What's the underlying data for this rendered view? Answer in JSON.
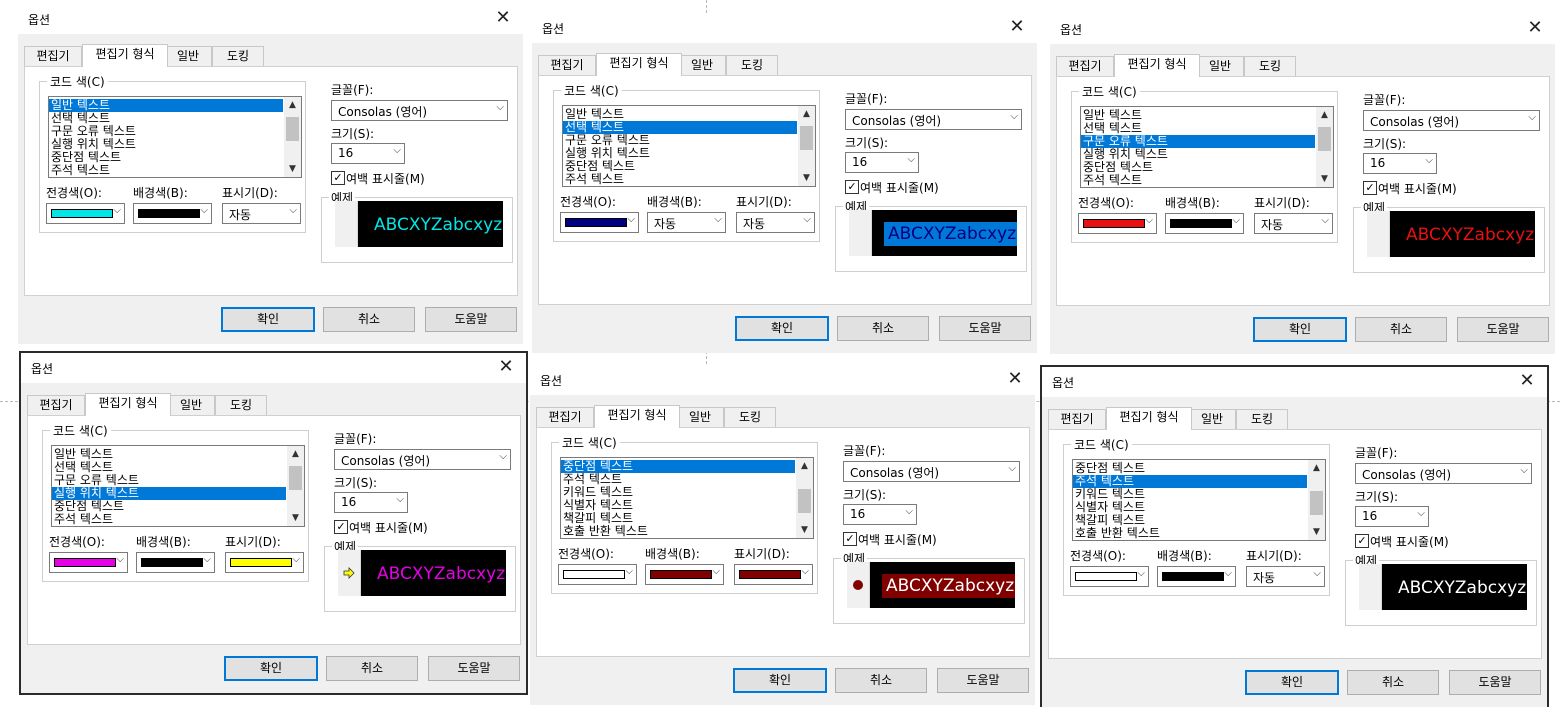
{
  "dialog": {
    "title": "옵션",
    "close_symbol": "✕",
    "tabs": [
      "편집기",
      "편집기 형식",
      "일반",
      "도킹"
    ],
    "group_label": "코드 색(C)",
    "fg_label": "전경색(O):",
    "bg_label": "배경색(B):",
    "indicator_label": "표시기(D):",
    "font_label": "글꼴(F):",
    "font_value": "Consolas (영어)",
    "size_label": "크기(S):",
    "size_value": "16",
    "margin_label": "여백 표시줄(M)",
    "margin_checked": true,
    "sample_label": "예제",
    "sample_text": "ABCXYZabcxyz",
    "buttons": [
      "확인",
      "취소",
      "도움말"
    ]
  },
  "panels": [
    {
      "items": [
        "일반 텍스트",
        "선택 텍스트",
        "구문 오류 텍스트",
        "실행 위치 텍스트",
        "중단점 텍스트",
        "주석 텍스트"
      ],
      "selected": 0,
      "thumb": 0.15,
      "fg": {
        "swatch": "#00e5e5"
      },
      "bg": {
        "swatch": "#000000"
      },
      "ind": {
        "text": "자동"
      },
      "preview": {
        "fg": "#00e5e5",
        "bg": "#000000"
      },
      "marker": "none"
    },
    {
      "items": [
        "일반 텍스트",
        "선택 텍스트",
        "구문 오류 텍스트",
        "실행 위치 텍스트",
        "중단점 텍스트",
        "주석 텍스트"
      ],
      "selected": 1,
      "thumb": 0.15,
      "fg": {
        "swatch": "#000080"
      },
      "bg": {
        "text": "자동"
      },
      "ind": {
        "text": "자동"
      },
      "preview": {
        "fg": "#000080",
        "bg": "#0078d7"
      },
      "marker": "none"
    },
    {
      "items": [
        "일반 텍스트",
        "선택 텍스트",
        "구문 오류 텍스트",
        "실행 위치 텍스트",
        "중단점 텍스트",
        "주석 텍스트"
      ],
      "selected": 2,
      "thumb": 0.15,
      "fg": {
        "swatch": "#e81010"
      },
      "bg": {
        "swatch": "#000000"
      },
      "ind": {
        "text": "자동"
      },
      "preview": {
        "fg": "#e81010",
        "bg": "#000000"
      },
      "marker": "none"
    },
    {
      "items": [
        "일반 텍스트",
        "선택 텍스트",
        "구문 오류 텍스트",
        "실행 위치 텍스트",
        "중단점 텍스트",
        "주석 텍스트"
      ],
      "selected": 3,
      "thumb": 0.15,
      "fg": {
        "swatch": "#e600e6"
      },
      "bg": {
        "swatch": "#000000"
      },
      "ind": {
        "swatch": "#ffff00"
      },
      "preview": {
        "fg": "#e600e6",
        "bg": "#000000"
      },
      "marker": "arrow"
    },
    {
      "items": [
        "중단점 텍스트",
        "주석 텍스트",
        "키워드 텍스트",
        "식별자 텍스트",
        "책갈피 텍스트",
        "호출 반환 텍스트"
      ],
      "selected": 0,
      "thumb": 0.62,
      "fg": {
        "swatch": "#ffffff"
      },
      "bg": {
        "swatch": "#800000"
      },
      "ind": {
        "swatch": "#800000"
      },
      "preview": {
        "fg": "#ffffff",
        "bg": "#800000"
      },
      "marker": "dot"
    },
    {
      "items": [
        "중단점 텍스트",
        "주석 텍스트",
        "키워드 텍스트",
        "식별자 텍스트",
        "책갈피 텍스트",
        "호출 반환 텍스트"
      ],
      "selected": 1,
      "thumb": 0.62,
      "fg": {
        "swatch": "#ffffff"
      },
      "bg": {
        "swatch": "#000000"
      },
      "ind": {
        "text": "자동"
      },
      "preview": {
        "fg": "#ffffff",
        "bg": "#000000"
      },
      "marker": "none"
    }
  ]
}
